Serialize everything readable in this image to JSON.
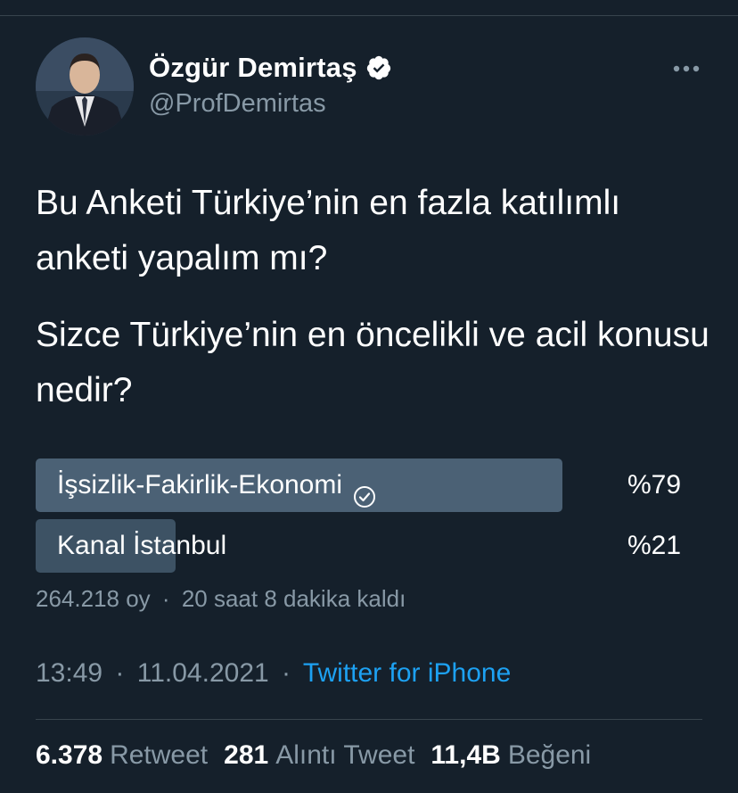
{
  "author": {
    "display_name": "Özgür Demirtaş",
    "handle": "@ProfDemirtas",
    "avatar_icon": "avatar-portrait"
  },
  "tweet": {
    "paragraphs": [
      "Bu Anketi Türkiye’nin en fazla katılımlı anketi yapalım mı?",
      "Sizce Türkiye’nin en öncelikli ve acil konusu nedir?"
    ]
  },
  "poll": {
    "options": [
      {
        "label": "İşsizlik-Fakirlik-Ekonomi",
        "percent_label": "%79",
        "percent": 79,
        "winner": true
      },
      {
        "label": "Kanal İstanbul",
        "percent_label": "%21",
        "percent": 21,
        "winner": false
      }
    ],
    "votes": "264.218 oy",
    "time_left": "20 saat 8 dakika kaldı"
  },
  "meta": {
    "time": "13:49",
    "date": "11.04.2021",
    "source": "Twitter for iPhone",
    "separator": "·"
  },
  "stats": {
    "retweets_count": "6.378",
    "retweets_label": "Retweet",
    "quotes_count": "281",
    "quotes_label": "Alıntı Tweet",
    "likes_count": "11,4B",
    "likes_label": "Beğeni"
  },
  "colors": {
    "background": "#15202b",
    "accent": "#1da1f2",
    "secondary_text": "#8899a6",
    "poll_bar_winner": "#4b6175",
    "poll_bar": "#3d5264"
  }
}
